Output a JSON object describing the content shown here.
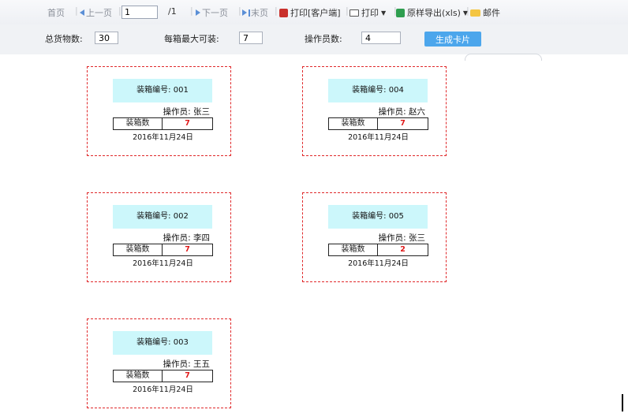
{
  "toolbar": {
    "first": "首页",
    "prev": "上一页",
    "page_value": "1",
    "page_total": "/1",
    "next": "下一页",
    "last": "末页",
    "print_client": "打印[客户端]",
    "print": "打印",
    "export": "原样导出(xls)",
    "mail": "邮件"
  },
  "form": {
    "total_label": "总货物数:",
    "total_value": "30",
    "per_box_label": "每箱最大可装:",
    "per_box_value": "7",
    "operators_label": "操作员数:",
    "operators_value": "4",
    "generate_button": "生成卡片"
  },
  "cards": [
    {
      "box": "装箱编号: 001",
      "operator": "操作员: 张三",
      "count_label": "装箱数",
      "count": "7",
      "date": "2016年11月24日"
    },
    {
      "box": "装箱编号: 004",
      "operator": "操作员: 赵六",
      "count_label": "装箱数",
      "count": "7",
      "date": "2016年11月24日"
    },
    {
      "box": "装箱编号: 002",
      "operator": "操作员: 李四",
      "count_label": "装箱数",
      "count": "7",
      "date": "2016年11月24日"
    },
    {
      "box": "装箱编号: 005",
      "operator": "操作员: 张三",
      "count_label": "装箱数",
      "count": "2",
      "date": "2016年11月24日"
    },
    {
      "box": "装箱编号: 003",
      "operator": "操作员: 王五",
      "count_label": "装箱数",
      "count": "7",
      "date": "2016年11月24日"
    }
  ],
  "colors": {
    "card_border": "#e0282a",
    "card_header_bg": "#ccf7fb",
    "count_text": "#e01818",
    "button_bg": "#4ca6ec"
  }
}
